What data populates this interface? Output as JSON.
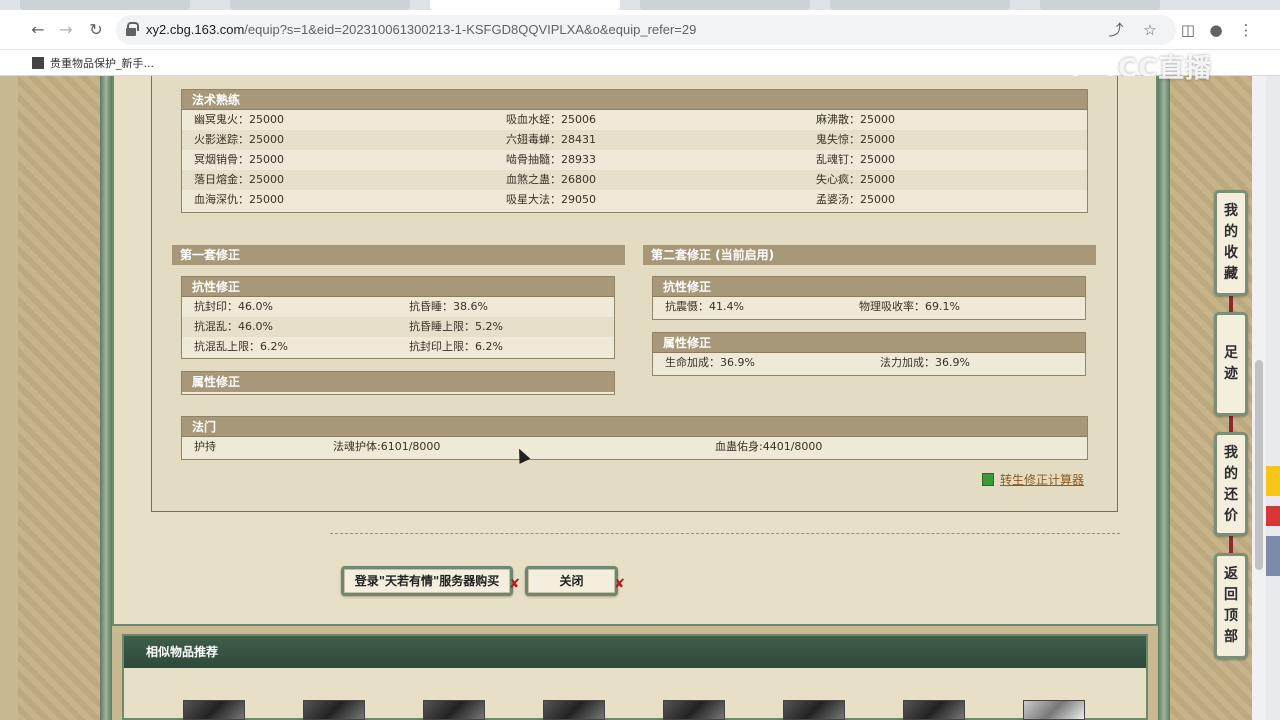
{
  "browser": {
    "url_host": "xy2.cbg.163.com",
    "url_path": "/equip?s=1&eid=202310061300213-1-KSFGD8QQVIPLXA&o&equip_refer=29",
    "bookmark": "贵重物品保护_新手...",
    "watermark": "CC直播"
  },
  "spell_mastery": {
    "title": "法术熟练",
    "rows": [
      [
        {
          "name": "幽冥鬼火",
          "value": "25000"
        },
        {
          "name": "吸血水蛭",
          "value": "25006"
        },
        {
          "name": "麻沸散",
          "value": "25000"
        }
      ],
      [
        {
          "name": "火影迷踪",
          "value": "25000"
        },
        {
          "name": "六翅毒蝉",
          "value": "28431"
        },
        {
          "name": "鬼失惊",
          "value": "25000"
        }
      ],
      [
        {
          "name": "冥烟销骨",
          "value": "25000"
        },
        {
          "name": "啮骨抽髓",
          "value": "28933"
        },
        {
          "name": "乱魂钉",
          "value": "25000"
        }
      ],
      [
        {
          "name": "落日熔金",
          "value": "25000"
        },
        {
          "name": "血煞之蛊",
          "value": "26800"
        },
        {
          "name": "失心疯",
          "value": "25000"
        }
      ],
      [
        {
          "name": "血海深仇",
          "value": "25000"
        },
        {
          "name": "吸星大法",
          "value": "29050"
        },
        {
          "name": "孟婆汤",
          "value": "25000"
        }
      ]
    ]
  },
  "correction_set1": {
    "title": "第一套修正",
    "resist": {
      "title": "抗性修正",
      "rows": [
        [
          {
            "name": "抗封印",
            "value": "46.0%"
          },
          {
            "name": "抗昏睡",
            "value": "38.6%"
          }
        ],
        [
          {
            "name": "抗混乱",
            "value": "46.0%"
          },
          {
            "name": "抗昏睡上限",
            "value": "5.2%"
          }
        ],
        [
          {
            "name": "抗混乱上限",
            "value": "6.2%"
          },
          {
            "name": "抗封印上限",
            "value": "6.2%"
          }
        ]
      ]
    },
    "attr": {
      "title": "属性修正"
    }
  },
  "correction_set2": {
    "title": "第二套修正 (当前启用)",
    "resist": {
      "title": "抗性修正",
      "rows": [
        [
          {
            "name": "抗震慑",
            "value": "41.4%"
          },
          {
            "name": "物理吸收率",
            "value": "69.1%"
          }
        ]
      ]
    },
    "attr": {
      "title": "属性修正",
      "rows": [
        [
          {
            "name": "生命加成",
            "value": "36.9%"
          },
          {
            "name": "法力加成",
            "value": "36.9%"
          }
        ]
      ]
    }
  },
  "fa_men": {
    "title": "法门",
    "col1": "护持",
    "col2": "法魂护体:6101/8000",
    "col3": "血蛊佑身:4401/8000"
  },
  "calc_link": "转生修正计算器",
  "buttons": {
    "login_buy": "登录\"天若有情\"服务器购买",
    "close": "关闭",
    "mark": "✘"
  },
  "similar": {
    "title": "相似物品推荐"
  },
  "sidenav": {
    "favorites": [
      "我",
      "的",
      "收",
      "藏"
    ],
    "footprints": [
      "足",
      "迹"
    ],
    "my_offers": [
      "我",
      "的",
      "还",
      "价"
    ],
    "back_top": [
      "返",
      "回",
      "顶",
      "部"
    ]
  }
}
